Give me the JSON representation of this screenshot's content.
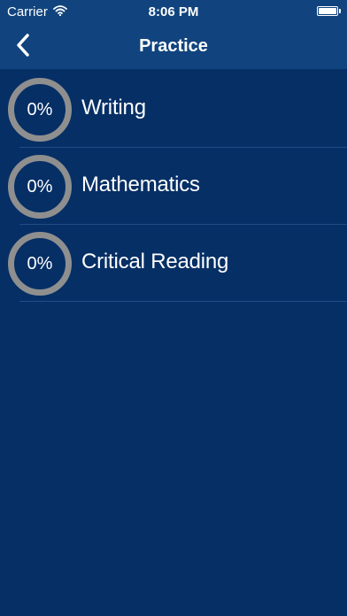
{
  "status_bar": {
    "carrier": "Carrier",
    "time": "8:06 PM",
    "battery_level": 1.0
  },
  "nav": {
    "title": "Practice",
    "back_icon": "chevron-left-icon"
  },
  "subjects": [
    {
      "progress_label": "0%",
      "progress": 0,
      "name": "Writing"
    },
    {
      "progress_label": "0%",
      "progress": 0,
      "name": "Mathematics"
    },
    {
      "progress_label": "0%",
      "progress": 0,
      "name": "Critical Reading"
    }
  ],
  "colors": {
    "background": "#062f66",
    "bar": "#11447e",
    "ring": "#8f8f8f",
    "separator": "#1e4c84",
    "text": "#ffffff"
  }
}
